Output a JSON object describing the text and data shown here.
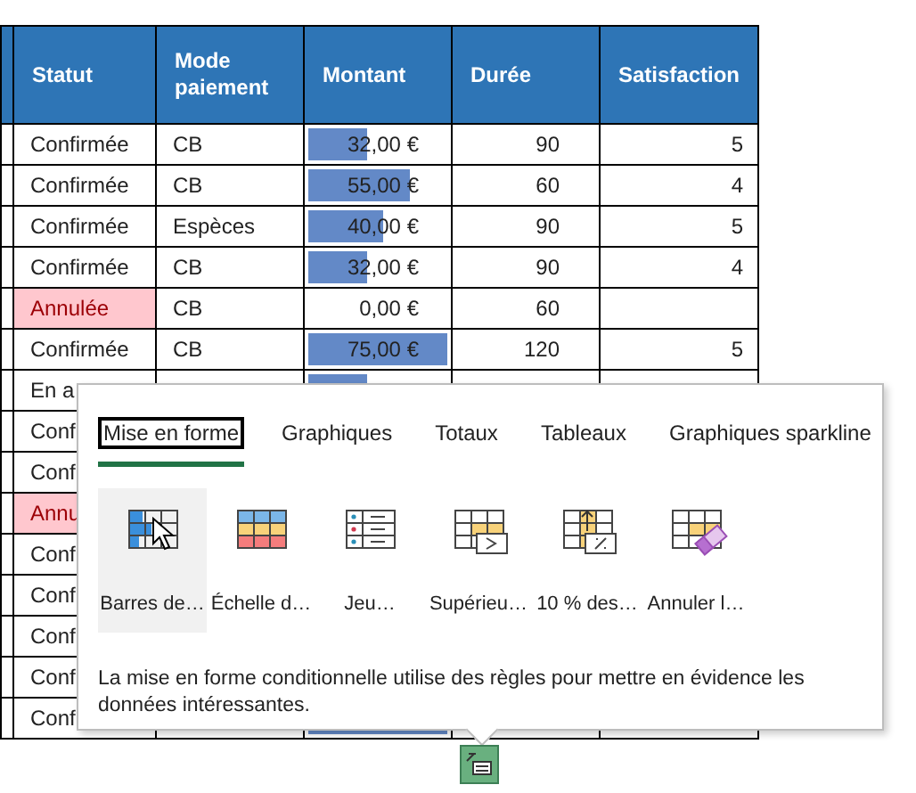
{
  "table": {
    "columns": [
      "Statut",
      "Mode paiement",
      "Montant",
      "Durée",
      "Satisfaction"
    ],
    "rows": [
      {
        "statut": "Confirmée",
        "highlighted": false,
        "mode": "CB",
        "montant": "32,00 €",
        "level": 0.427,
        "duree": "90",
        "satisfaction": "5"
      },
      {
        "statut": "Confirmée",
        "highlighted": false,
        "mode": "CB",
        "montant": "55,00 €",
        "level": 0.733,
        "duree": "60",
        "satisfaction": "4"
      },
      {
        "statut": "Confirmée",
        "highlighted": false,
        "mode": "Espèces",
        "montant": "40,00 €",
        "level": 0.533,
        "duree": "90",
        "satisfaction": "5"
      },
      {
        "statut": "Confirmée",
        "highlighted": false,
        "mode": "CB",
        "montant": "32,00 €",
        "level": 0.427,
        "duree": "90",
        "satisfaction": "4"
      },
      {
        "statut": "Annulée",
        "highlighted": true,
        "mode": "CB",
        "montant": "0,00 €",
        "duree": "60"
      },
      {
        "statut": "Confirmée",
        "highlighted": false,
        "mode": "CB",
        "montant": "75,00 €",
        "level": 1,
        "duree": "120",
        "satisfaction": "5"
      },
      {
        "statut": "En a",
        "highlighted": false,
        "level": 0.427
      },
      {
        "statut": "Conf",
        "highlighted": false
      },
      {
        "statut": "Conf",
        "highlighted": false
      },
      {
        "statut": "Annu",
        "highlighted": true
      },
      {
        "statut": "Conf",
        "highlighted": false
      },
      {
        "statut": "Conf",
        "highlighted": false
      },
      {
        "statut": "Conf",
        "highlighted": false
      },
      {
        "statut": "Conf",
        "highlighted": false
      },
      {
        "statut": "Conf",
        "highlighted": false,
        "level": 1
      }
    ]
  },
  "quick_analysis": {
    "tabs": [
      {
        "label": "Mise en forme",
        "selected": true
      },
      {
        "label": "Graphiques",
        "selected": false
      },
      {
        "label": "Totaux",
        "selected": false
      },
      {
        "label": "Tableaux",
        "selected": false
      },
      {
        "label": "Graphiques sparkline",
        "selected": false
      }
    ],
    "items": [
      {
        "label": "Barres de…",
        "kind": "data-bars",
        "selected": true
      },
      {
        "label": "Échelle d…",
        "kind": "color-scale",
        "selected": false
      },
      {
        "label": "Jeu…",
        "kind": "icon-set",
        "selected": false
      },
      {
        "label": "Supérieu…",
        "kind": "greater-than",
        "selected": false
      },
      {
        "label": "10 % des…",
        "kind": "top-percent",
        "selected": false
      },
      {
        "label": "Annuler l…",
        "kind": "clear",
        "selected": false
      }
    ],
    "description": "La mise en forme conditionnelle utilise des règles pour mettre en évidence les données intéressantes."
  }
}
